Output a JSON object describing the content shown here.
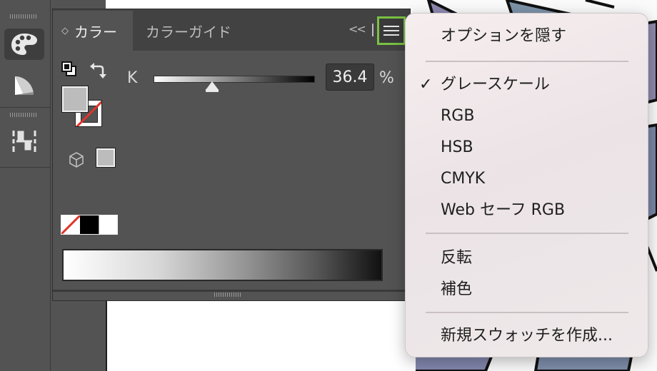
{
  "panel": {
    "tabs": [
      {
        "label": "カラー",
        "active": true
      },
      {
        "label": "カラーガイド",
        "active": false
      }
    ],
    "collapse_label": "<<",
    "k_label": "K",
    "k_value": "36.4",
    "k_unit": "%",
    "k_slider_level": 0.364
  },
  "menu": {
    "items": [
      {
        "label": "オプションを隠す",
        "checked": false
      },
      {
        "label": "グレースケール",
        "checked": true
      },
      {
        "label": "RGB",
        "checked": false
      },
      {
        "label": "HSB",
        "checked": false
      },
      {
        "label": "CMYK",
        "checked": false
      },
      {
        "label": "Web セーフ RGB",
        "checked": false
      },
      {
        "label": "反転",
        "checked": false
      },
      {
        "label": "補色",
        "checked": false
      },
      {
        "label": "新規スウォッチを作成...",
        "checked": false
      }
    ],
    "check_mark": "✓"
  },
  "colors": {
    "fill": "#bcbcbc",
    "highlight": "#7ac143",
    "none_slash": "#e0352b"
  }
}
